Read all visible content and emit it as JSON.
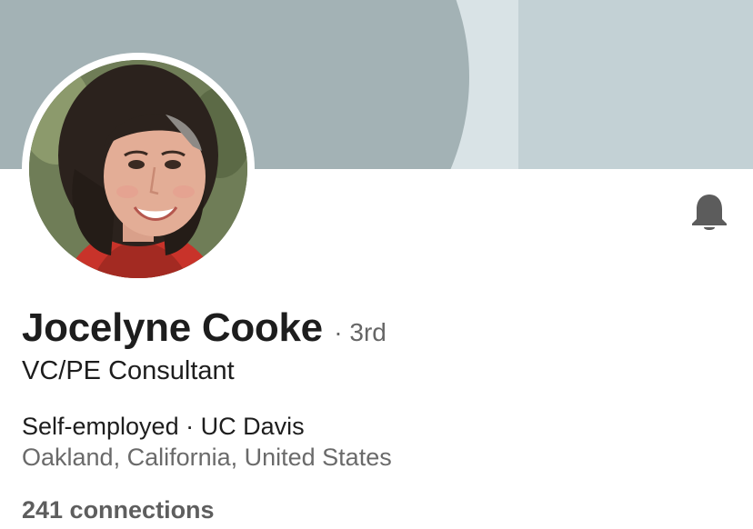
{
  "profile": {
    "name": "Jocelyne Cooke",
    "degree": "· 3rd",
    "headline": "VC/PE Consultant",
    "company_education": "Self-employed · UC Davis",
    "location": "Oakland, California, United States",
    "connections": "241 connections"
  },
  "icons": {
    "notification": "bell-icon",
    "avatar": "profile-photo"
  },
  "colors": {
    "cover_background": "#c3d1d5",
    "cover_curve_dark": "#a3b2b5",
    "cover_curve_light": "#d9e3e6",
    "text_primary": "#1d1d1d",
    "text_secondary": "#6a6a6a",
    "bell": "#5c5c5c"
  }
}
